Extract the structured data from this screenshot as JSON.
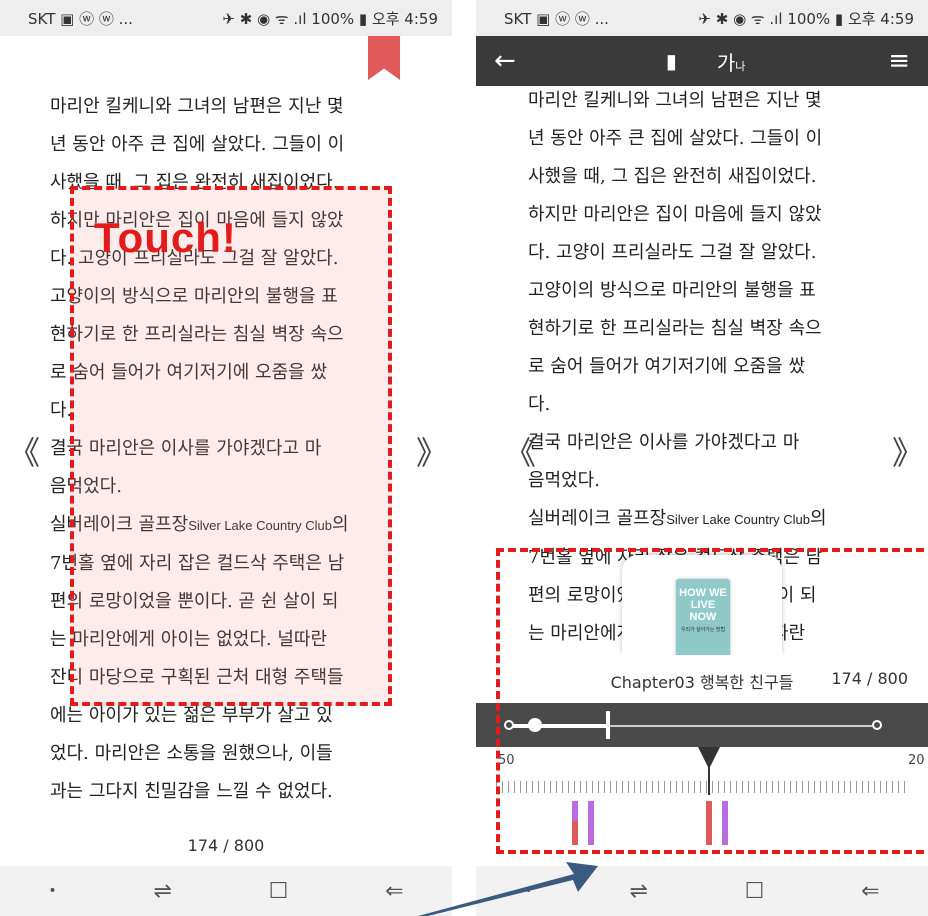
{
  "status_bar": {
    "carrier": "SKT ▣ ⓦ ⓦ ...",
    "indicators": "✈ ✱ ◉ ᯤ .ıl 100% ▮ 오후 4:59"
  },
  "book_text": {
    "left": [
      "마리안 킬케니와 그녀의 남편은 지난 몇",
      "년 동안 아주 큰 집에 살았다. 그들이 이",
      "사했을 때, 그 집은 완전히 새집이었다.",
      "하지만 마리안은 집이 마음에 들지 않았",
      "다. 고양이 프리실라도 그걸 잘 알았다.",
      "고양이의 방식으로 마리안의 불행을 표",
      "현하기로 한 프리실라는 침실 벽장 속으",
      "로 숨어 들어가 여기저기에 오줌을 쌌",
      "다.",
      "    결국 마리안은 이사를 가야겠다고 마",
      "음먹었다.",
      "    실버레이크 골프장"
    ],
    "left_small": "Silver Lake Country Club",
    "left_after": "의",
    "left_rest": [
      "7번홀 옆에 자리 잡은 컬드삭 주택은 남",
      "편의 로망이었을 뿐이다. 곧 쉰 살이 되",
      "는 마리안에게 아이는 없었다. 널따란",
      "잔디 마당으로 구획된 근처 대형 주택들",
      "에는 아이가 있는 젊은 부부가 살고 있",
      "었다. 마리안은 소통을 원했으나, 이들",
      "과는 그다지 친밀감을 느낄 수 없었다."
    ],
    "right_rest": [
      "7번홀 옆에 자리 잡은 컬드삭 주택은 남",
      "편의 로망이었을 뿐이다. 곧 쉰 살이 되",
      "는 마리안에게 아이는 없었다. 널따란"
    ]
  },
  "page_indicator": "174 / 800",
  "touch_label": "Touch!",
  "toolbar": {
    "back": "←",
    "bookmark": "▮",
    "font": "가",
    "font_sub": "나",
    "menu": "≡"
  },
  "panel": {
    "chapter": "Chapter03 행복한 친구들",
    "page": "174 / 800",
    "ruler_left": "50",
    "ruler_right": "20"
  },
  "book_cover": {
    "title": "HOW WE LIVE NOW",
    "subtitle": "우리가 살아가는 방법"
  },
  "arrows": {
    "prev": "《",
    "next": "》"
  },
  "nav": {
    "dot": "•",
    "recent": "⇌",
    "home": "☐",
    "back": "⇐"
  },
  "colors": {
    "highlight_red": "#e41b1b",
    "mark_red": "#e05a5a",
    "mark_purple": "#b86ce0"
  }
}
